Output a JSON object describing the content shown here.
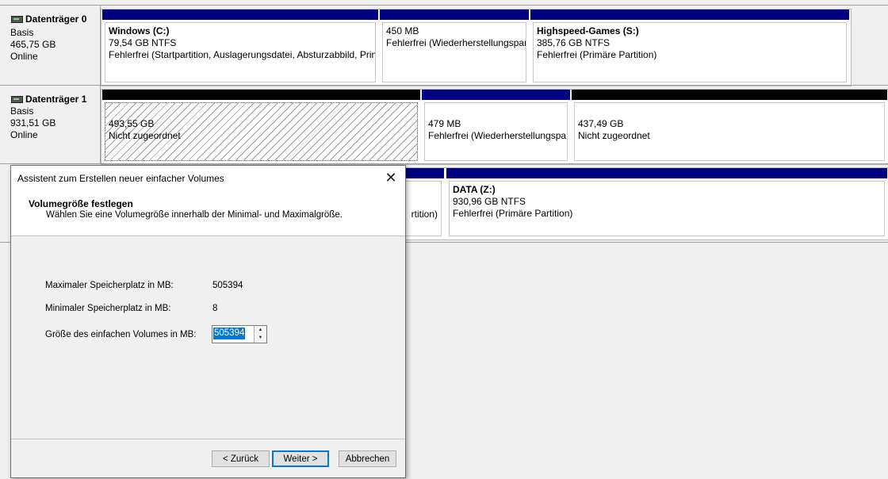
{
  "disks": [
    {
      "title": "Datenträger 0",
      "type": "Basis",
      "size": "465,75 GB",
      "status": "Online",
      "partitions": [
        {
          "name": "Windows  (C:)",
          "size": "79,54 GB NTFS",
          "status": "Fehlerfrei (Startpartition, Auslagerungsdatei, Absturzabbild, Prim"
        },
        {
          "name": "",
          "size": "450 MB",
          "status": "Fehlerfrei (Wiederherstellungspar"
        },
        {
          "name": "Highspeed-Games  (S:)",
          "size": "385,76 GB NTFS",
          "status": "Fehlerfrei (Primäre Partition)"
        }
      ]
    },
    {
      "title": "Datenträger 1",
      "type": "Basis",
      "size": "931,51 GB",
      "status": "Online",
      "partitions": [
        {
          "name": "",
          "size": "493,55 GB",
          "status": "Nicht zugeordnet"
        },
        {
          "name": "",
          "size": "479 MB",
          "status": "Fehlerfrei (Wiederherstellungspar"
        },
        {
          "name": "",
          "size": "437,49 GB",
          "status": "Nicht zugeordnet"
        }
      ]
    },
    {
      "partitions": [
        {
          "name": "",
          "size": "",
          "status": "rtition)"
        },
        {
          "name": "DATA  (Z:)",
          "size": "930,96 GB NTFS",
          "status": "Fehlerfrei (Primäre Partition)"
        }
      ]
    }
  ],
  "dialog": {
    "title": "Assistent zum Erstellen neuer einfacher Volumes",
    "close": "✕",
    "heading": "Volumegröße festlegen",
    "subheading": "Wählen Sie eine Volumegröße innerhalb der Minimal- und Maximalgröße.",
    "max_label": "Maximaler Speicherplatz in MB:",
    "max_value": "505394",
    "min_label": "Minimaler Speicherplatz in MB:",
    "min_value": "8",
    "size_label": "Größe des einfachen Volumes in MB:",
    "size_value": "505394",
    "back_button": "< Zurück",
    "next_button": "Weiter >",
    "cancel_button": "Abbrechen"
  },
  "colors": {
    "primary_partition_bar": "#000080",
    "unallocated_bar": "#000000",
    "selection": "#0078d7"
  },
  "icons": {
    "disk": "disk-drive-icon",
    "close": "close-icon",
    "spin_up": "chevron-up-icon",
    "spin_down": "chevron-down-icon"
  }
}
